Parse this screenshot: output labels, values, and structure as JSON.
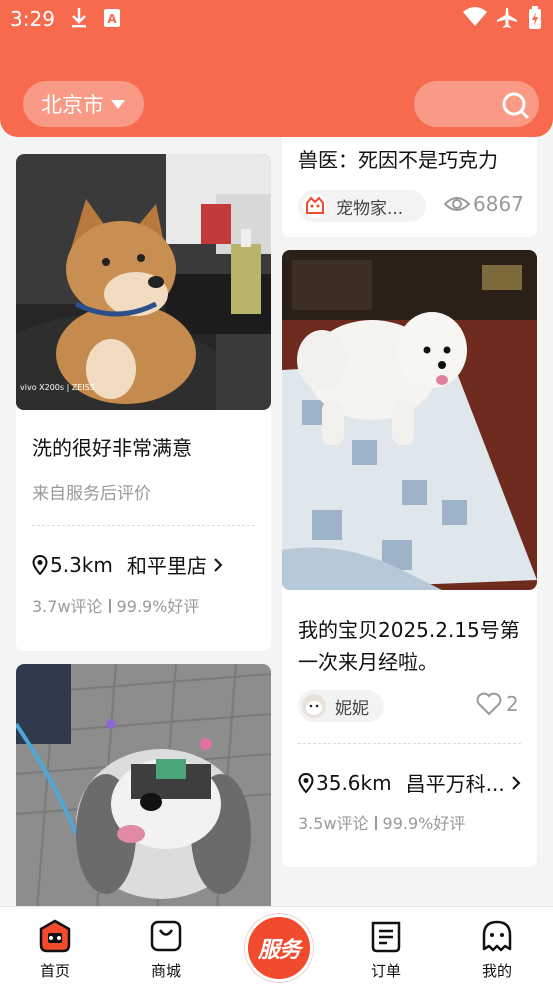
{
  "status_bar": {
    "time": "3:29"
  },
  "header": {
    "city": "北京市"
  },
  "colors": {
    "brand": "#f76a4e",
    "service_button": "#f14a2c"
  },
  "feed": {
    "left": [
      {
        "title": "洗的很好非常满意",
        "subtitle": "来自服务后评价",
        "distance": "5.3km",
        "store": "和平里店",
        "reviews": "3.7w评论",
        "rating": "99.9%好评"
      },
      {}
    ],
    "right": [
      {
        "title": "兽医：死因不是巧克力",
        "author": "宠物家...",
        "views": "6867"
      },
      {
        "title_line1": "我的宝贝2025.2.15号第",
        "title_line2": "一次来月经啦。",
        "author": "妮妮",
        "likes": "2",
        "distance": "35.6km",
        "store": "昌平万科...",
        "reviews": "3.5w评论",
        "rating": "99.9%好评"
      }
    ]
  },
  "tab_bar": {
    "home": "首页",
    "mall": "商城",
    "service": "服务",
    "orders": "订单",
    "mine": "我的"
  }
}
